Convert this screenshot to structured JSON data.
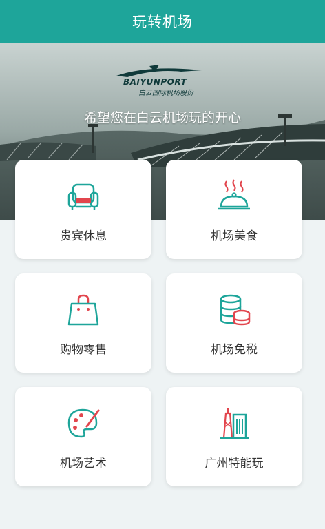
{
  "header": {
    "title": "玩转机场"
  },
  "hero": {
    "logo_en": "BAIYUNPORT",
    "logo_cn": "白云国际机场股份",
    "slogan": "希望您在白云机场玩的开心"
  },
  "menu": [
    {
      "label": "贵宾休息",
      "icon": "sofa-icon"
    },
    {
      "label": "机场美食",
      "icon": "food-cloche-icon"
    },
    {
      "label": "购物零售",
      "icon": "shopping-bag-icon"
    },
    {
      "label": "机场免税",
      "icon": "coins-icon"
    },
    {
      "label": "机场艺术",
      "icon": "art-palette-icon"
    },
    {
      "label": "广州特能玩",
      "icon": "city-buildings-icon"
    }
  ],
  "colors": {
    "teal": "#1ea59a",
    "red": "#e2454d",
    "background": "#eef3f4"
  }
}
